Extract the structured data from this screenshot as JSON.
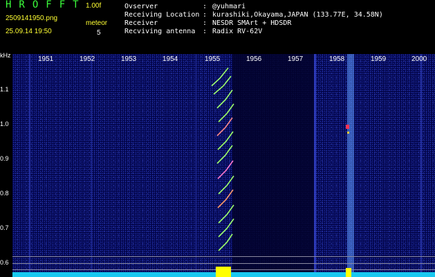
{
  "app": {
    "title": "HROFFT",
    "version": "1.00f"
  },
  "file": {
    "name": "2509141950.png",
    "datetime": "25.09.14 19:50"
  },
  "meteor": {
    "label": "meteor",
    "count": "5"
  },
  "meta": [
    {
      "key": "Ovserver",
      "value": "@yuhmari"
    },
    {
      "key": "Receiving Location",
      "value": "kurashiki,Okayama,JAPAN (133.77E, 34.58N)"
    },
    {
      "key": "Receiver",
      "value": "NESDR SMArt + HDSDR"
    },
    {
      "key": "Recviving antenna",
      "value": "Radix RV-62V"
    }
  ],
  "y_axis": {
    "unit": "kHz",
    "ticks": [
      "1.1",
      "1.0",
      "0.9",
      "0.8",
      "0.7",
      "0.6"
    ]
  },
  "x_axis": {
    "ticks": [
      "1951",
      "1952",
      "1953",
      "1954",
      "1955",
      "1956",
      "1957",
      "1958",
      "1959",
      "2000"
    ]
  },
  "colors": {
    "background": "#000000",
    "spectrum": "#03054a",
    "title": "#3cff3c",
    "meteor_burst": "#ffff00",
    "baseline": "#19c8f0"
  }
}
